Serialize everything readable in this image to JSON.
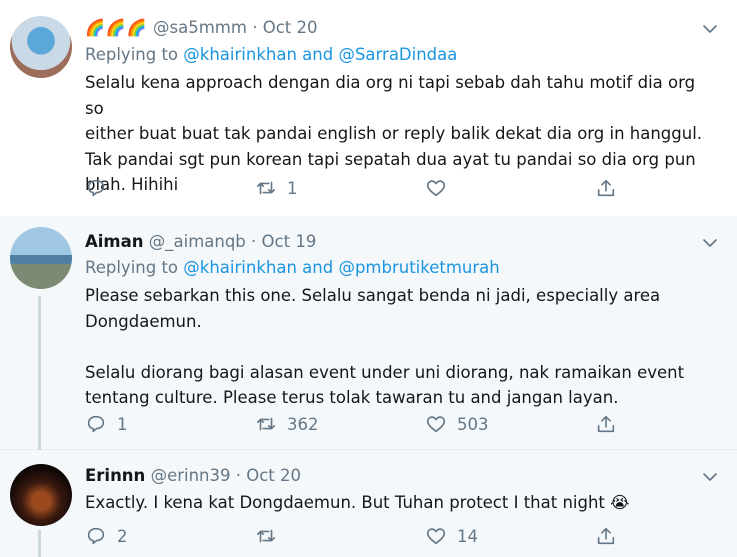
{
  "tweets": [
    {
      "display_name": "🌈🌈🌈",
      "handle": "@sa5mmm",
      "separator": "·",
      "date": "Oct 20",
      "replying_prefix": "Replying to ",
      "replying_to_1": "@khairinkhan",
      "replying_and": " and ",
      "replying_to_2": "@SarraDindaa",
      "text": "Selalu kena approach dengan dia org ni tapi sebab dah tahu motif dia org so\neither buat buat tak pandai english or reply balik dekat dia org in hanggul.\nTak pandai sgt pun korean tapi sepatah dua ayat tu pandai so dia org pun\nblah. Hihihi",
      "reply_count": "",
      "retweet_count": "1",
      "like_count": ""
    },
    {
      "display_name": "Aiman",
      "handle": "@_aimanqb",
      "separator": "·",
      "date": "Oct 19",
      "replying_prefix": "Replying to ",
      "replying_to_1": "@khairinkhan",
      "replying_and": " and ",
      "replying_to_2": "@pmbrutiketmurah",
      "text": "Please sebarkan this one. Selalu sangat benda ni jadi, especially area\nDongdaemun.\n\nSelalu diorang bagi alasan event under uni diorang, nak ramaikan event\ntentang culture. Please terus tolak tawaran tu and jangan layan.",
      "reply_count": "1",
      "retweet_count": "362",
      "like_count": "503"
    },
    {
      "display_name": "Erinnn",
      "handle": "@erinn39",
      "separator": "·",
      "date": "Oct 20",
      "text": "Exactly. I kena kat Dongdaemun. But Tuhan protect I that night 😭",
      "reply_count": "2",
      "retweet_count": "",
      "like_count": "14"
    }
  ],
  "icons": {
    "reply": "speech-bubble-icon",
    "retweet": "retweet-arrows-icon",
    "like": "heart-outline-icon",
    "share": "share-upload-icon",
    "more": "chevron-down-icon"
  },
  "colors": {
    "link": "#1b95e0",
    "muted": "#657786",
    "highlight_bg": "#f5f8fa"
  }
}
